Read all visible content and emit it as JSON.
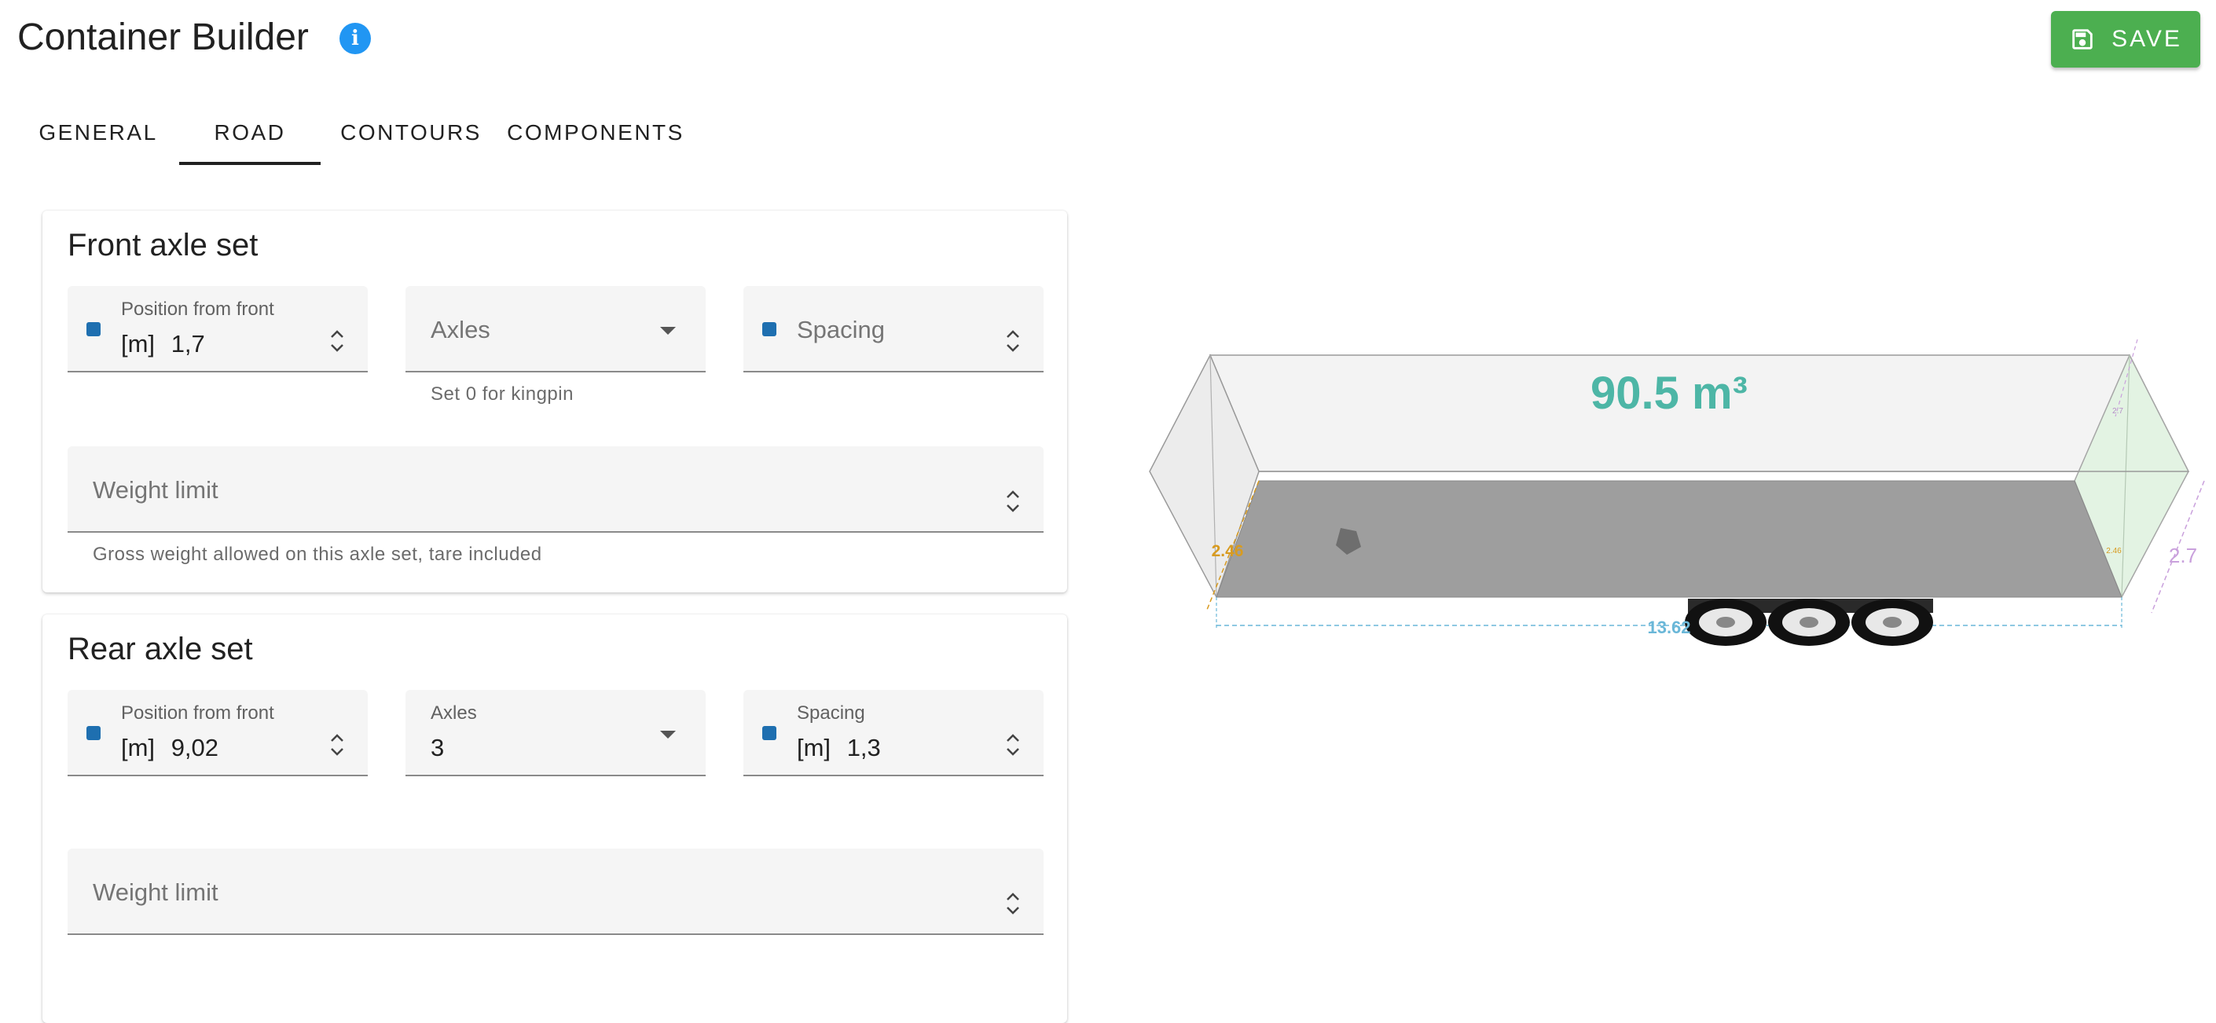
{
  "header": {
    "title": "Container Builder",
    "info_icon": "info-icon",
    "save_label": "SAVE",
    "save_icon": "floppy-disk-icon"
  },
  "tabs": [
    {
      "label": "GENERAL",
      "active": false
    },
    {
      "label": "ROAD",
      "active": true
    },
    {
      "label": "CONTOURS",
      "active": false
    },
    {
      "label": "COMPONENTS",
      "active": false
    }
  ],
  "front_axle_set": {
    "title": "Front axle set",
    "position": {
      "label": "Position from front",
      "unit": "[m]",
      "value": "1,7"
    },
    "axles": {
      "label": "Axles",
      "value": "",
      "hint": "Set 0 for kingpin"
    },
    "spacing": {
      "label": "Spacing",
      "value": ""
    },
    "weight_limit": {
      "label": "Weight limit",
      "value": "",
      "hint": "Gross weight allowed on this axle set, tare included"
    }
  },
  "rear_axle_set": {
    "title": "Rear axle set",
    "position": {
      "label": "Position from front",
      "unit": "[m]",
      "value": "9,02"
    },
    "axles": {
      "label": "Axles",
      "value": "3"
    },
    "spacing": {
      "label": "Spacing",
      "unit": "[m]",
      "value": "1,3"
    },
    "weight_limit": {
      "label": "Weight limit",
      "value": ""
    }
  },
  "viewer": {
    "volume_label": "90.5 m³",
    "length_label": "13.62",
    "height_label": "2.46",
    "width_label": "2.7",
    "small_label_a": "2.7",
    "small_label_b": "2.46",
    "wheel_count": 3,
    "colors": {
      "volume": "#4db6a6",
      "floor": "#9e9e9e",
      "rear_panel": "#e3f3e3",
      "height_dim": "#d89b20",
      "width_dim": "#c9a0dc",
      "length_dim": "#6ab7d8"
    }
  }
}
